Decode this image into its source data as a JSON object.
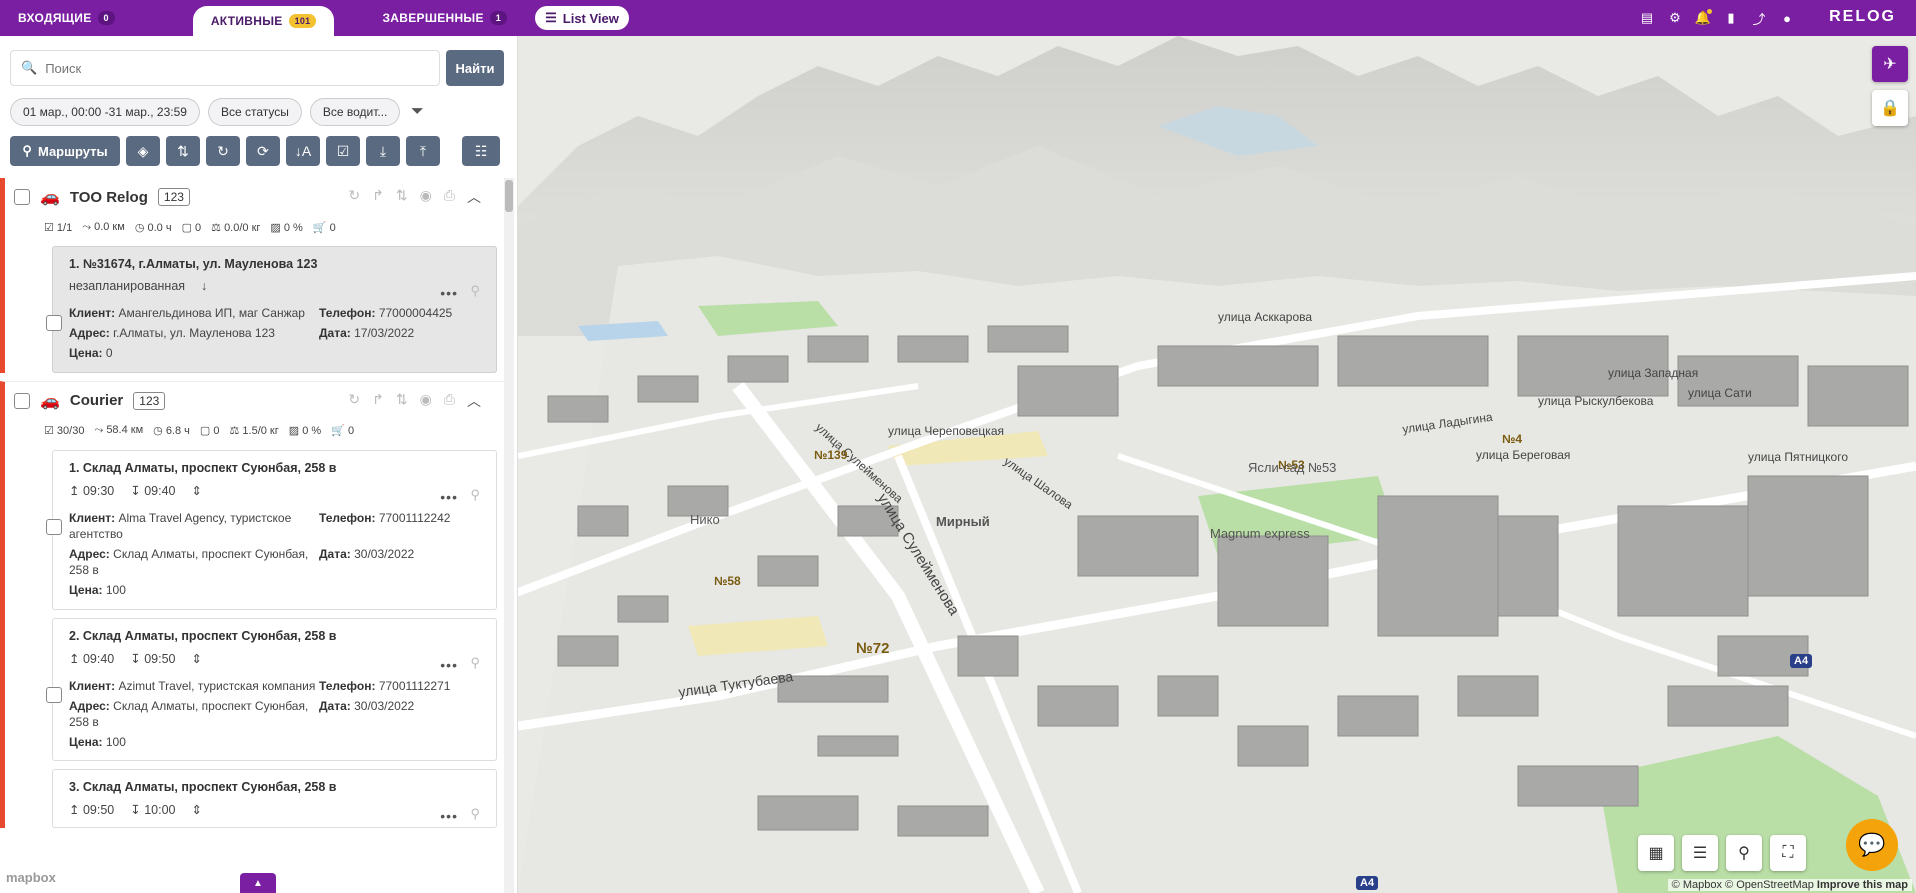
{
  "topbar": {
    "tabs": [
      {
        "label": "ВХОДЯЩИЕ",
        "count": "0"
      },
      {
        "label": "АКТИВНЫЕ",
        "count": "101"
      },
      {
        "label": "ЗАВЕРШЕННЫЕ",
        "count": "1"
      }
    ],
    "list_view_label": "List View",
    "logo": "RELOG",
    "icons": [
      "document-icon",
      "gear-icon",
      "bell-icon",
      "bar-chart-icon",
      "share-icon",
      "user-icon"
    ]
  },
  "search": {
    "placeholder": "Поиск",
    "button_label": "Найти"
  },
  "filters": {
    "date_range": "01 мар., 00:00 -31 мар., 23:59",
    "status": "Все статусы",
    "drivers": "Все водит..."
  },
  "toolbar": {
    "routes_label": "Маршруты"
  },
  "groups": [
    {
      "name": "ТОО Relog",
      "count": "123",
      "stats": {
        "orders": "1/1",
        "distance": "0.0 км",
        "time": "0.0 ч",
        "boxes": "0",
        "weight": "0.0/0 кг",
        "load": "0 %",
        "carts": "0"
      },
      "cards": [
        {
          "title": "1. №31674, г.Алматы, ул. Мауленова 123",
          "status": "незапланированная",
          "client_label": "Клиент:",
          "client": "Амангельдинова ИП, маг Санжар",
          "phone_label": "Телефон:",
          "phone": "77000004425",
          "address_label": "Адрес:",
          "address": "г.Алматы, ул. Мауленова 123",
          "date_label": "Дата:",
          "date": "17/03/2022",
          "price_label": "Цена:",
          "price": "0"
        }
      ]
    },
    {
      "name": "Courier",
      "count": "123",
      "stats": {
        "orders": "30/30",
        "distance": "58.4 км",
        "time": "6.8 ч",
        "boxes": "0",
        "weight": "1.5/0 кг",
        "load": "0 %",
        "carts": "0"
      },
      "cards": [
        {
          "title": "1. Склад Алматы, проспект Суюнбая, 258 в",
          "arrive": "09:30",
          "depart": "09:40",
          "client_label": "Клиент:",
          "client": "Alma Travel Agency, туристское агентство",
          "phone_label": "Телефон:",
          "phone": "77001112242",
          "address_label": "Адрес:",
          "address": "Склад Алматы, проспект Суюнбая, 258 в",
          "date_label": "Дата:",
          "date": "30/03/2022",
          "price_label": "Цена:",
          "price": "100"
        },
        {
          "title": "2. Склад Алматы, проспект Суюнбая, 258 в",
          "arrive": "09:40",
          "depart": "09:50",
          "client_label": "Клиент:",
          "client": "Azimut Travel, туристская компания",
          "phone_label": "Телефон:",
          "phone": "77001112271",
          "address_label": "Адрес:",
          "address": "Склад Алматы, проспект Суюнбая, 258 в",
          "date_label": "Дата:",
          "date": "30/03/2022",
          "price_label": "Цена:",
          "price": "100"
        },
        {
          "title": "3. Склад Алматы, проспект Суюнбая, 258 в",
          "arrive": "09:50",
          "depart": "10:00"
        }
      ]
    }
  ],
  "map": {
    "streets": [
      "улица Сулейменова",
      "улица Сулейменова",
      "улица Туктубаева",
      "улица Шалова",
      "улица Череповецкая",
      "улица Береговая",
      "улица Ладыгина",
      "улица Рыскулбекова",
      "улица Асккарова",
      "улица Сати",
      "улица Пятницкого",
      "улица Западная"
    ],
    "pois": [
      "№58",
      "№72",
      "№139",
      "№53",
      "№4",
      "Мирный",
      "Magnum express",
      "Нико",
      "Ясли-сад №53"
    ],
    "road_badges": [
      "A4",
      "A4"
    ],
    "attribution_1": "© Mapbox",
    "attribution_2": "© OpenStreetMap",
    "attribution_3": "Improve this map",
    "mapbox_logo": "mapbox"
  }
}
